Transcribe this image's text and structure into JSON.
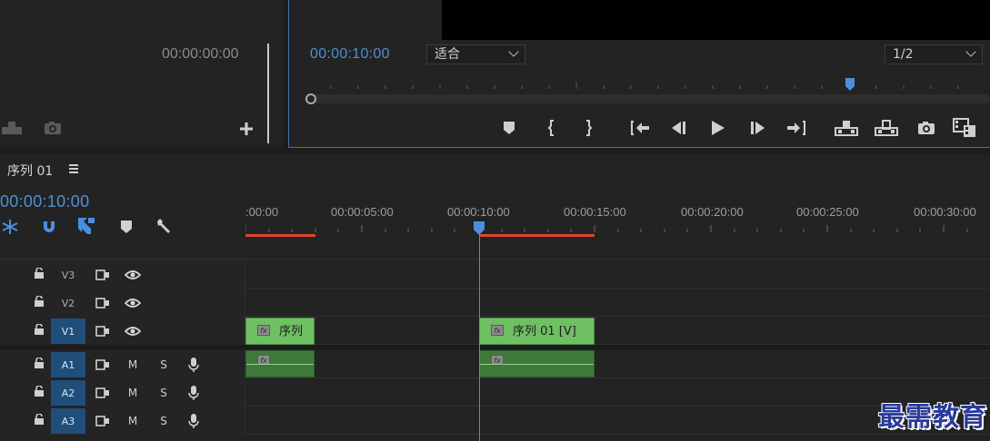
{
  "source_monitor": {
    "timecode": "00:00:00:00",
    "icons": [
      "export-frame-icon",
      "camera-icon",
      "add-icon"
    ]
  },
  "program_monitor": {
    "timecode": "00:00:10:00",
    "zoom_value": "适合",
    "resolution_value": "1/2",
    "controls": [
      "add-marker-icon",
      "mark-in-icon",
      "mark-out-icon",
      "go-to-in-icon",
      "step-back-icon",
      "play-icon",
      "step-forward-icon",
      "go-to-out-icon",
      "lift-icon",
      "extract-icon",
      "camera-icon",
      "compare-icon"
    ]
  },
  "timeline": {
    "tab_label": "序列 01",
    "timecode": "00:00:10:00",
    "ruler_labels": [
      ":00:00",
      "00:00:05:00",
      "00:00:10:00",
      "00:00:15:00",
      "00:00:20:00",
      "00:00:25:00",
      "00:00:30:00"
    ],
    "tracks": [
      {
        "label": "V3",
        "type": "video",
        "active": false
      },
      {
        "label": "V2",
        "type": "video",
        "active": false
      },
      {
        "label": "V1",
        "type": "video",
        "active": true
      },
      {
        "label": "A1",
        "type": "audio",
        "active": true
      },
      {
        "label": "A2",
        "type": "audio",
        "active": true
      },
      {
        "label": "A3",
        "type": "audio",
        "active": true
      }
    ],
    "mute_label": "M",
    "solo_label": "S",
    "clips": {
      "v1_clip1_name": "序列",
      "v1_clip2_name": "序列 01 [V]",
      "fx_label": "fx"
    }
  },
  "watermark": "最需教育",
  "colors": {
    "accent_blue": "#4f8fd6",
    "video_clip": "#6fbf63",
    "audio_clip": "#3f7a3a",
    "work_area_red": "#e0452d"
  }
}
